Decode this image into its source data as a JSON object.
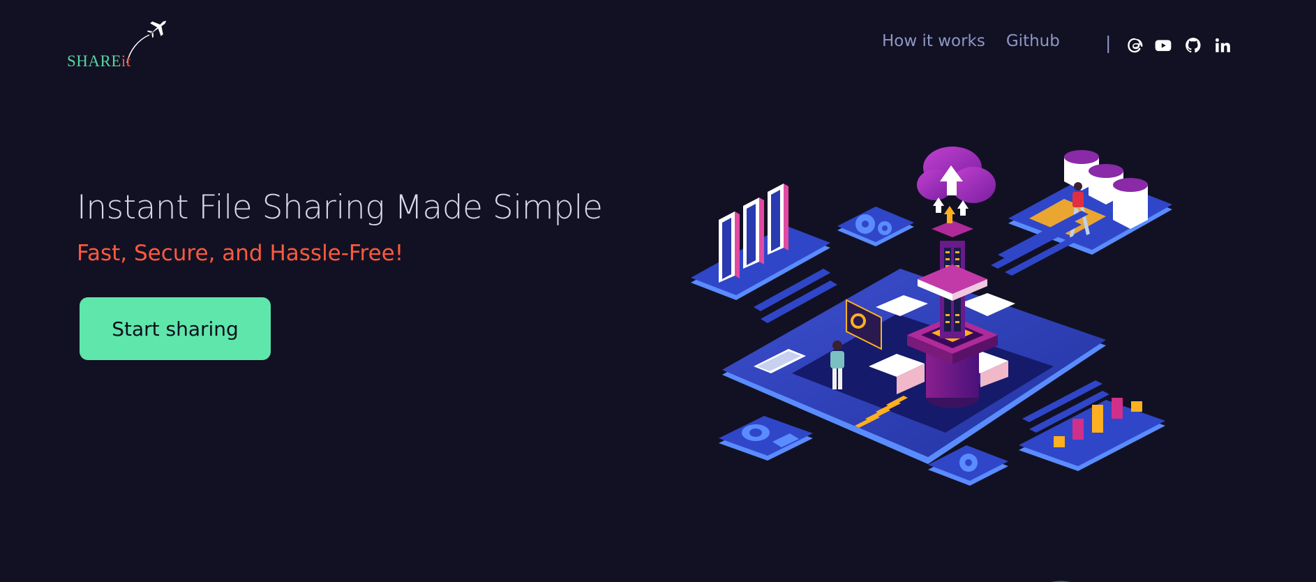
{
  "logo": {
    "text_main": "SHARE",
    "text_accent": "it"
  },
  "nav": {
    "how_it_works": "How it works",
    "github": "Github",
    "separator": "|"
  },
  "social": [
    "threads-icon",
    "youtube-icon",
    "github-icon",
    "linkedin-icon"
  ],
  "hero": {
    "title": "Instant File Sharing Made Simple",
    "subtitle": "Fast, Secure, and Hassle-Free!",
    "cta_label": "Start sharing"
  },
  "colors": {
    "background": "#121123",
    "accent_green": "#5fe6ab",
    "accent_orange": "#ff5a3c",
    "nav_text": "#8e96c6"
  }
}
